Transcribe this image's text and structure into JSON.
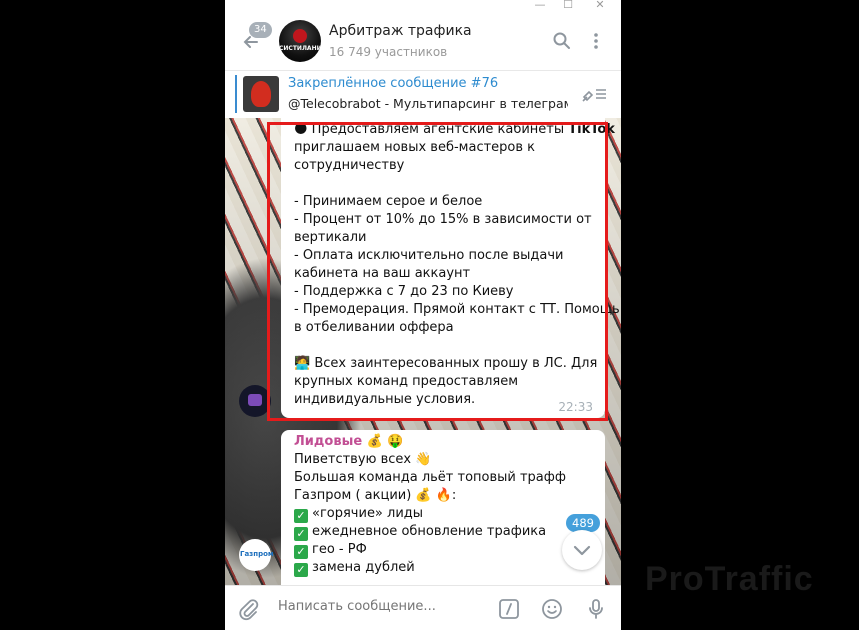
{
  "chat": {
    "title": "Арбитраж трафика",
    "subtitle": "16 749 участников",
    "unread": "34",
    "avatar_text": "СИСТИЛАНИЩЕ"
  },
  "pinned": {
    "title": "Закреплённое сообщение #76",
    "text": "@Telecobrabot - Мультипарсинг в телеграм"
  },
  "messages": [
    {
      "lines": [
        "🌑 Предоставляем агентские кабинеты TikTok",
        "приглашаем новых веб-мастеров к",
        "сотрудничеству",
        "",
        "- Принимаем серое и белое",
        "- Процент от 10% до 15% в зависимости от",
        "вертикали",
        "- Оплата исключительно после выдачи",
        "кабинета на ваш аккаунт",
        "- Поддержка с 7 до 23 по Киеву",
        "- Премодерация. Прямой контакт с ТТ. Помощь",
        "в отбеливании оффера",
        "",
        "🧑‍💻 Всех заинтересованных прошу в ЛС. Для",
        "крупных команд предоставляем",
        "индивидуальные условия."
      ],
      "time": "22:33"
    },
    {
      "sender": "Лидовые 💰 🤑",
      "lines": [
        "Пиветствую всех 👋",
        "Большая команда льёт топовый трафф",
        "Газпром ( акции) 💰 🔥:",
        "«горячие» лиды",
        "ежедневное обновление трафика",
        "гео - РФ",
        "замена дублей"
      ],
      "sender_avatar": "Газпром"
    }
  ],
  "scroll": {
    "count": "489"
  },
  "composer": {
    "placeholder": "Написать сообщение..."
  },
  "watermark": "ProTraffic",
  "colors": {
    "link": "#2d8bcf",
    "sender": "#c24f94",
    "highlight": "#e51b1b",
    "badge": "#45a0db"
  }
}
